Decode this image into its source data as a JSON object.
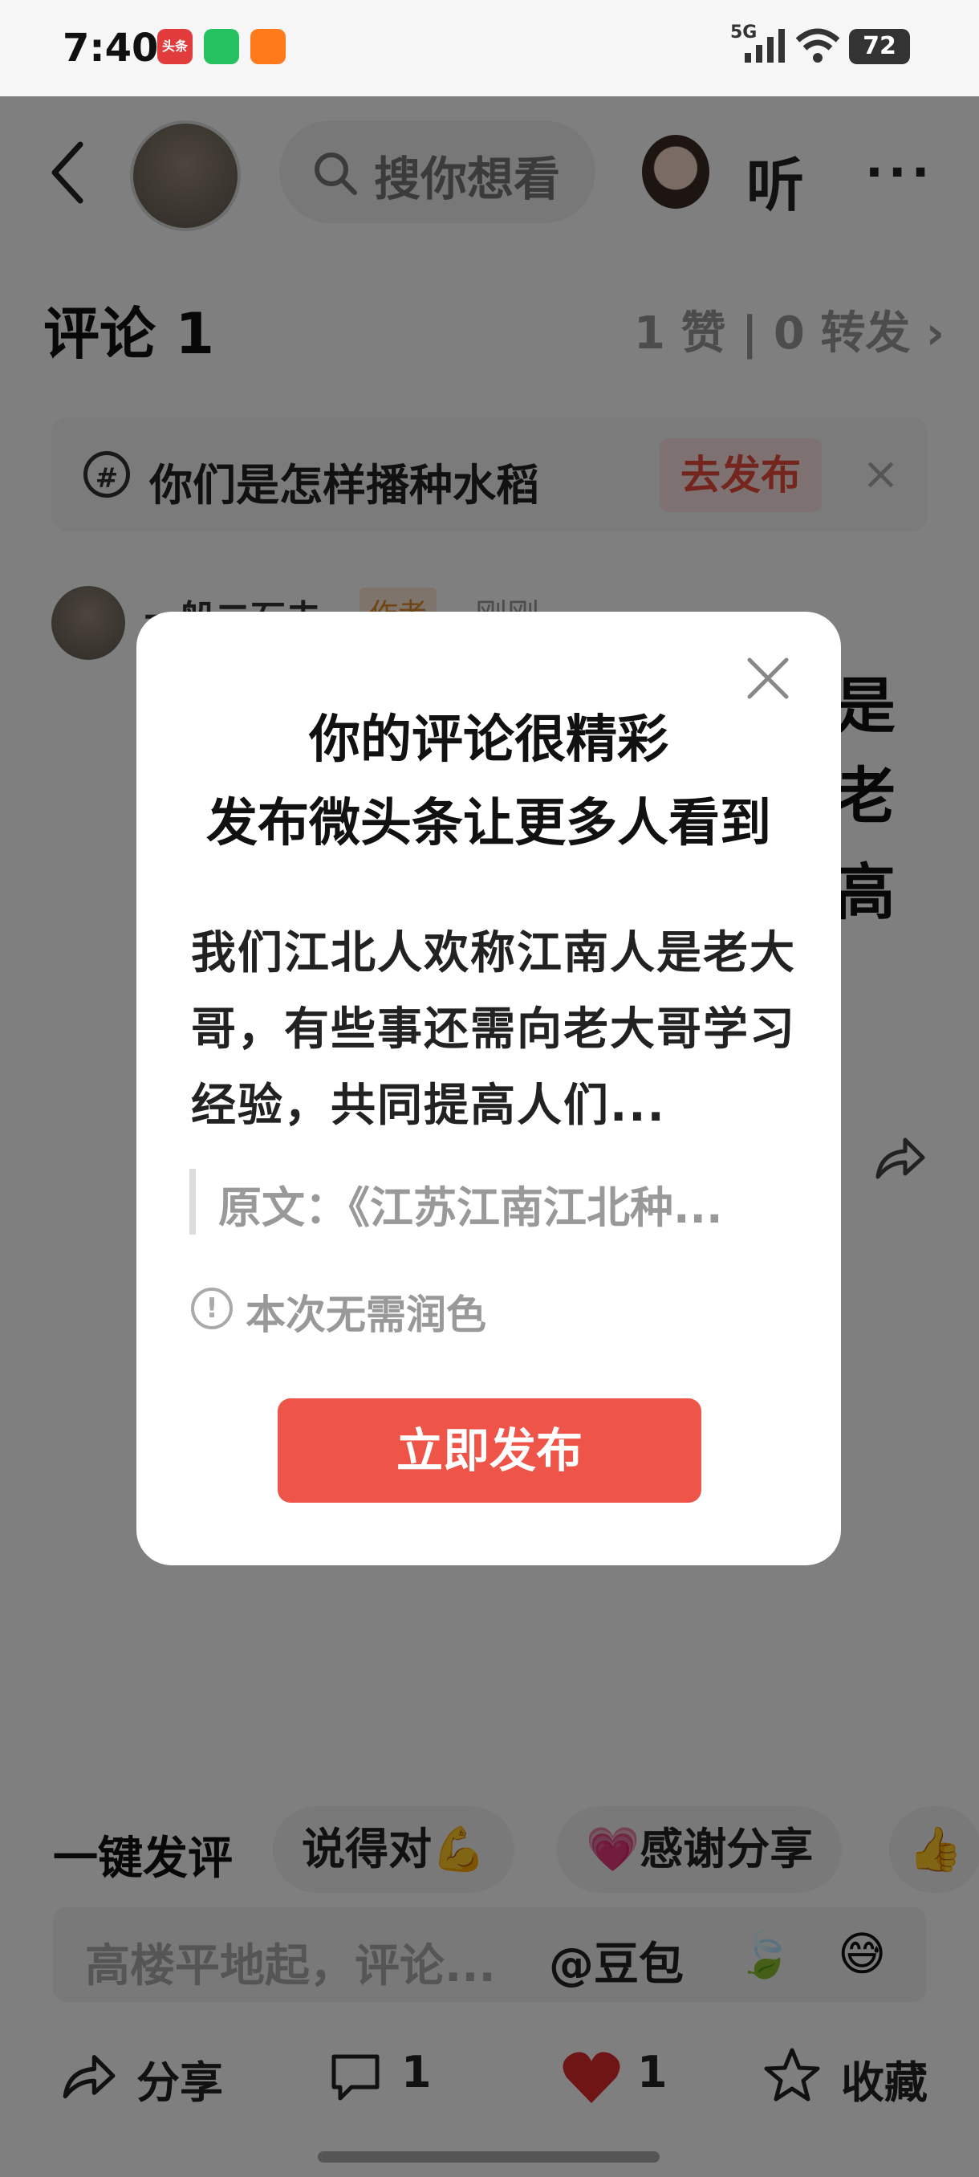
{
  "status_bar": {
    "time": "7:40",
    "apps": [
      "头条",
      "",
      ""
    ],
    "network": "5G",
    "battery": "72"
  },
  "header": {
    "search_placeholder": "搜你想看",
    "listen_label": "听",
    "more_label": "···"
  },
  "comments": {
    "title": "评论 1",
    "stats": "1 赞 | 0 转发 ›"
  },
  "topic_bar": {
    "text": "你们是怎样播种水稻",
    "button": "去发布",
    "close": "×"
  },
  "comment": {
    "author": "一船二石夫",
    "tag": "作者",
    "time": "刚刚",
    "side_chars": [
      "是",
      "老",
      "高"
    ]
  },
  "dialog": {
    "title_line1": "你的评论很精彩",
    "title_line2": "发布微头条让更多人看到",
    "body": "我们江北人欢称江南人是老大哥，有些事还需向老大哥学习经验，共同提高人们...",
    "quote": "原文：《江苏江南江北种...",
    "hint": "本次无需润色",
    "publish_button": "立即发布"
  },
  "quick_reply": {
    "label": "一键发评",
    "chips": [
      "说得对💪",
      "💗感谢分享",
      "👍"
    ]
  },
  "input": {
    "placeholder": "高楼平地起，评论...",
    "doubao": "@豆包",
    "leaf": "🍃",
    "emoji": "😅"
  },
  "bottom_bar": {
    "share": "分享",
    "comment_count": "1",
    "like_count": "1",
    "favorite": "收藏"
  },
  "colors": {
    "accent_red": "#ee5447",
    "like_red": "#e02a2a",
    "overlay": "rgba(0,0,0,0.5)"
  }
}
